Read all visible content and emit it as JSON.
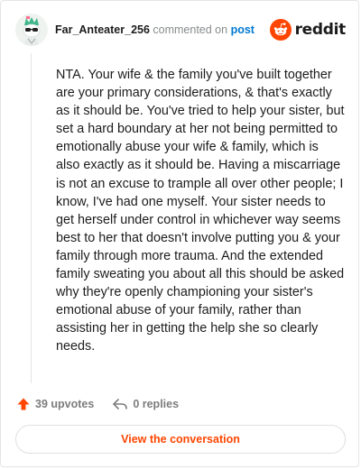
{
  "header": {
    "username": "Far_Anteater_256",
    "action_text": "commented on",
    "post_link": "post",
    "brand": "reddit"
  },
  "comment": {
    "body": "NTA. Your wife & the family you've built together are your primary considerations, & that's exactly as it should be. You've tried to help your sister, but set a hard boundary at her not being permitted to emotionally abuse your wife & family, which is also exactly as it should be. Having a miscarriage is not an excuse to trample all over other people; I know, I've had one myself. Your sister needs to get herself under control in whichever way seems best to her that doesn't involve putting you & your family through more trauma. And the extended family sweating you about all this should be asked why they're openly championing your sister's emotional abuse of your family, rather than assisting her in getting the help she so clearly needs."
  },
  "actions": {
    "upvotes_label": "39 upvotes",
    "replies_label": "0 replies"
  },
  "cta": {
    "label": "View the conversation"
  },
  "icons": {
    "avatar": "snoo-avatar-icon",
    "brand": "reddit-snoo-icon",
    "upvote": "upvote-arrow-icon",
    "reply": "reply-arrow-icon"
  },
  "colors": {
    "brand_orange": "#ff4500",
    "link_blue": "#0079d3",
    "text_primary": "#1c1c1c",
    "text_muted": "#878a8c"
  }
}
